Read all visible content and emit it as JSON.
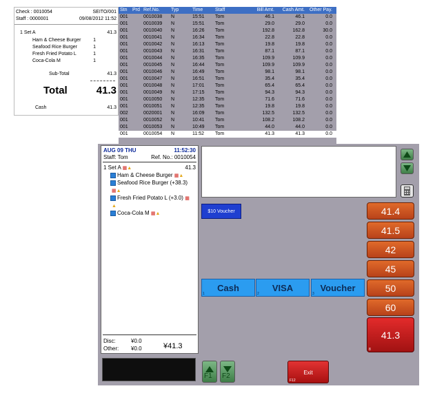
{
  "receipt": {
    "check_label": "Check : 0010054",
    "terminal": "SEITO/001",
    "staff_label": "Staff : 0000001",
    "datetime": "09/08/2012 11:52",
    "set_line": "1  Set A",
    "set_price": "41.3",
    "items": [
      {
        "name": "Ham & Cheese Burger",
        "qty": "1"
      },
      {
        "name": "Seafood Rice Burger",
        "qty": "1"
      },
      {
        "name": "Fresh Fried Potato L",
        "qty": "1"
      },
      {
        "name": "Coca-Cola M",
        "qty": "1"
      }
    ],
    "subtotal_label": "Sub-Total",
    "subtotal_value": "41.3",
    "total_label": "Total",
    "total_value": "41.3",
    "cash_label": "Cash",
    "cash_value": "41.3"
  },
  "txlist": {
    "headers": [
      "Stn",
      "Prd",
      "Ref.No.",
      "Typ",
      "Time",
      "Staff",
      "Bill Amt.",
      "Cash Amt.",
      "Other Pay."
    ],
    "rows": [
      [
        "001",
        "",
        "0010038",
        "N",
        "15:51",
        "Tom",
        "46.1",
        "46.1",
        "0.0"
      ],
      [
        "001",
        "",
        "0010039",
        "N",
        "15:51",
        "Tom",
        "29.0",
        "29.0",
        "0.0"
      ],
      [
        "001",
        "",
        "0010040",
        "N",
        "16:26",
        "Tom",
        "192.8",
        "162.8",
        "30.0"
      ],
      [
        "001",
        "",
        "0010041",
        "N",
        "16:34",
        "Tom",
        "22.8",
        "22.8",
        "0.0"
      ],
      [
        "001",
        "",
        "0010042",
        "N",
        "16:13",
        "Tom",
        "19.8",
        "19.8",
        "0.0"
      ],
      [
        "001",
        "",
        "0010043",
        "N",
        "16:31",
        "Tom",
        "87.1",
        "87.1",
        "0.0"
      ],
      [
        "001",
        "",
        "0010044",
        "N",
        "16:35",
        "Tom",
        "109.9",
        "109.9",
        "0.0"
      ],
      [
        "001",
        "",
        "0010045",
        "N",
        "16:44",
        "Tom",
        "109.9",
        "109.9",
        "0.0"
      ],
      [
        "001",
        "",
        "0010046",
        "N",
        "16:49",
        "Tom",
        "98.1",
        "98.1",
        "0.0"
      ],
      [
        "001",
        "",
        "0010047",
        "N",
        "16:51",
        "Tom",
        "35.4",
        "35.4",
        "0.0"
      ],
      [
        "001",
        "",
        "0010048",
        "N",
        "17:01",
        "Tom",
        "65.4",
        "65.4",
        "0.0"
      ],
      [
        "001",
        "",
        "0010049",
        "N",
        "17:15",
        "Tom",
        "94.3",
        "94.3",
        "0.0"
      ],
      [
        "001",
        "",
        "0010050",
        "N",
        "12:35",
        "Tom",
        "71.6",
        "71.6",
        "0.0"
      ],
      [
        "001",
        "",
        "0010051",
        "N",
        "12:35",
        "Tom",
        "19.8",
        "19.8",
        "0.0"
      ],
      [
        "002",
        "",
        "0020001",
        "N",
        "16:09",
        "Tom",
        "132.5",
        "132.5",
        "0.0"
      ],
      [
        "001",
        "",
        "0010052",
        "N",
        "10:41",
        "Tom",
        "108.2",
        "108.2",
        "0.0"
      ],
      [
        "001",
        "",
        "0010053",
        "N",
        "10:49",
        "Tom",
        "44.0",
        "44.0",
        "0.0"
      ],
      [
        "001",
        "",
        "0010054",
        "N",
        "11:52",
        "Tom",
        "41.3",
        "41.3",
        "0.0"
      ]
    ]
  },
  "order": {
    "date": "AUG 09 THU",
    "time": "11:52:30",
    "staff": "Staff: Tom",
    "ref": "Ref. No.: 0010054",
    "set_line": "1 Set A",
    "set_price": "41.3",
    "items": [
      "Ham & Cheese Burger",
      "Seafood Rice Burger (+38.3)",
      "Fresh Fried Potato L (+3.0)",
      "Coca-Cola M"
    ],
    "disc_label": "Disc:",
    "disc_value": "¥0.0",
    "other_label": "Other:",
    "other_value": "¥0.0",
    "grand_total": "¥41.3"
  },
  "buttons": {
    "voucher10": "$10 Voucher",
    "cash": "Cash",
    "visa": "VISA",
    "voucher": "Voucher",
    "cash_hotkey": "1",
    "visa_hotkey": "2",
    "voucher_hotkey": "3",
    "amounts": [
      "41.4",
      "41.5",
      "42",
      "45",
      "50",
      "60"
    ],
    "exact_amount": "41.3",
    "exact_hotkey": "8",
    "exit": "Exit",
    "exit_fkey": "F12",
    "nav_up_fkey": "F1",
    "nav_down_fkey": "F2"
  },
  "colors": {
    "header_blue": "#3d6fc4",
    "panel_gray": "#a39fab",
    "pay_blue": "#2b9cf0",
    "amount_orange": "#c8521f",
    "exit_red": "#c81d1d"
  }
}
